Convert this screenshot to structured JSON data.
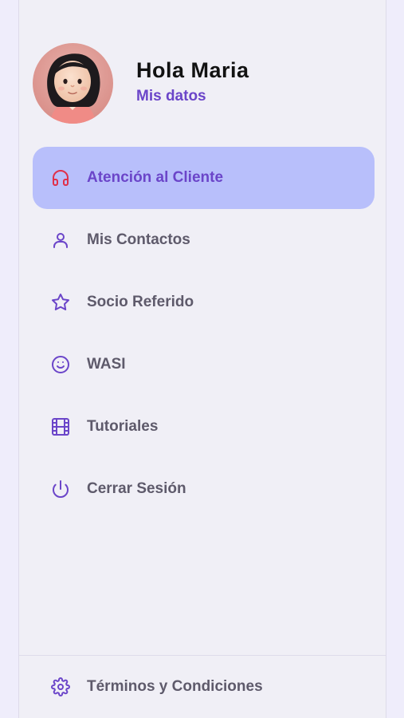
{
  "profile": {
    "greeting": "Hola Maria",
    "link_label": "Mis datos"
  },
  "menu": {
    "items": [
      {
        "label": "Atención al Cliente",
        "icon": "headphones-icon",
        "active": true
      },
      {
        "label": "Mis Contactos",
        "icon": "user-icon",
        "active": false
      },
      {
        "label": "Socio Referido",
        "icon": "star-icon",
        "active": false
      },
      {
        "label": "WASI",
        "icon": "smile-icon",
        "active": false
      },
      {
        "label": "Tutoriales",
        "icon": "film-icon",
        "active": false
      },
      {
        "label": "Cerrar Sesión",
        "icon": "power-icon",
        "active": false
      }
    ]
  },
  "footer": {
    "label": "Términos y Condiciones",
    "icon": "gear-icon"
  },
  "colors": {
    "accent": "#6b45c9",
    "active_background": "#b8bffb",
    "active_icon": "#e0304a",
    "text_muted": "#5e5a6b",
    "background": "#f0eff6"
  }
}
